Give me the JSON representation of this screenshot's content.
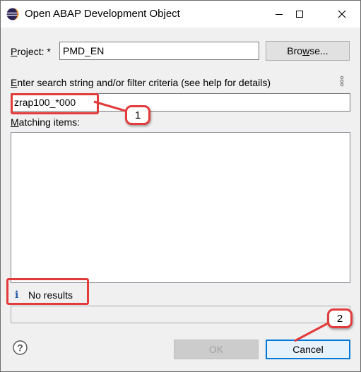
{
  "window": {
    "title": "Open ABAP Development Object",
    "icon": "eclipse-icon"
  },
  "project": {
    "label_prefix": "P",
    "label_rest": "roject: *",
    "value": "PMD_EN",
    "browse_label_prefix": "Bro",
    "browse_label_u": "w",
    "browse_label_rest": "se..."
  },
  "search": {
    "label_prefix": "E",
    "label_rest": "nter search string and/or filter criteria (see help for details)",
    "value": "zrap100_*000"
  },
  "matching": {
    "label_prefix": "M",
    "label_rest": "atching items:"
  },
  "status": {
    "icon": "info-icon",
    "text": "No results"
  },
  "footer": {
    "ok_label": "OK",
    "cancel_label": "Cancel",
    "help_icon": "help-icon"
  },
  "annotations": {
    "callout_1": "1",
    "callout_2": "2",
    "color": "#e23b3b"
  }
}
